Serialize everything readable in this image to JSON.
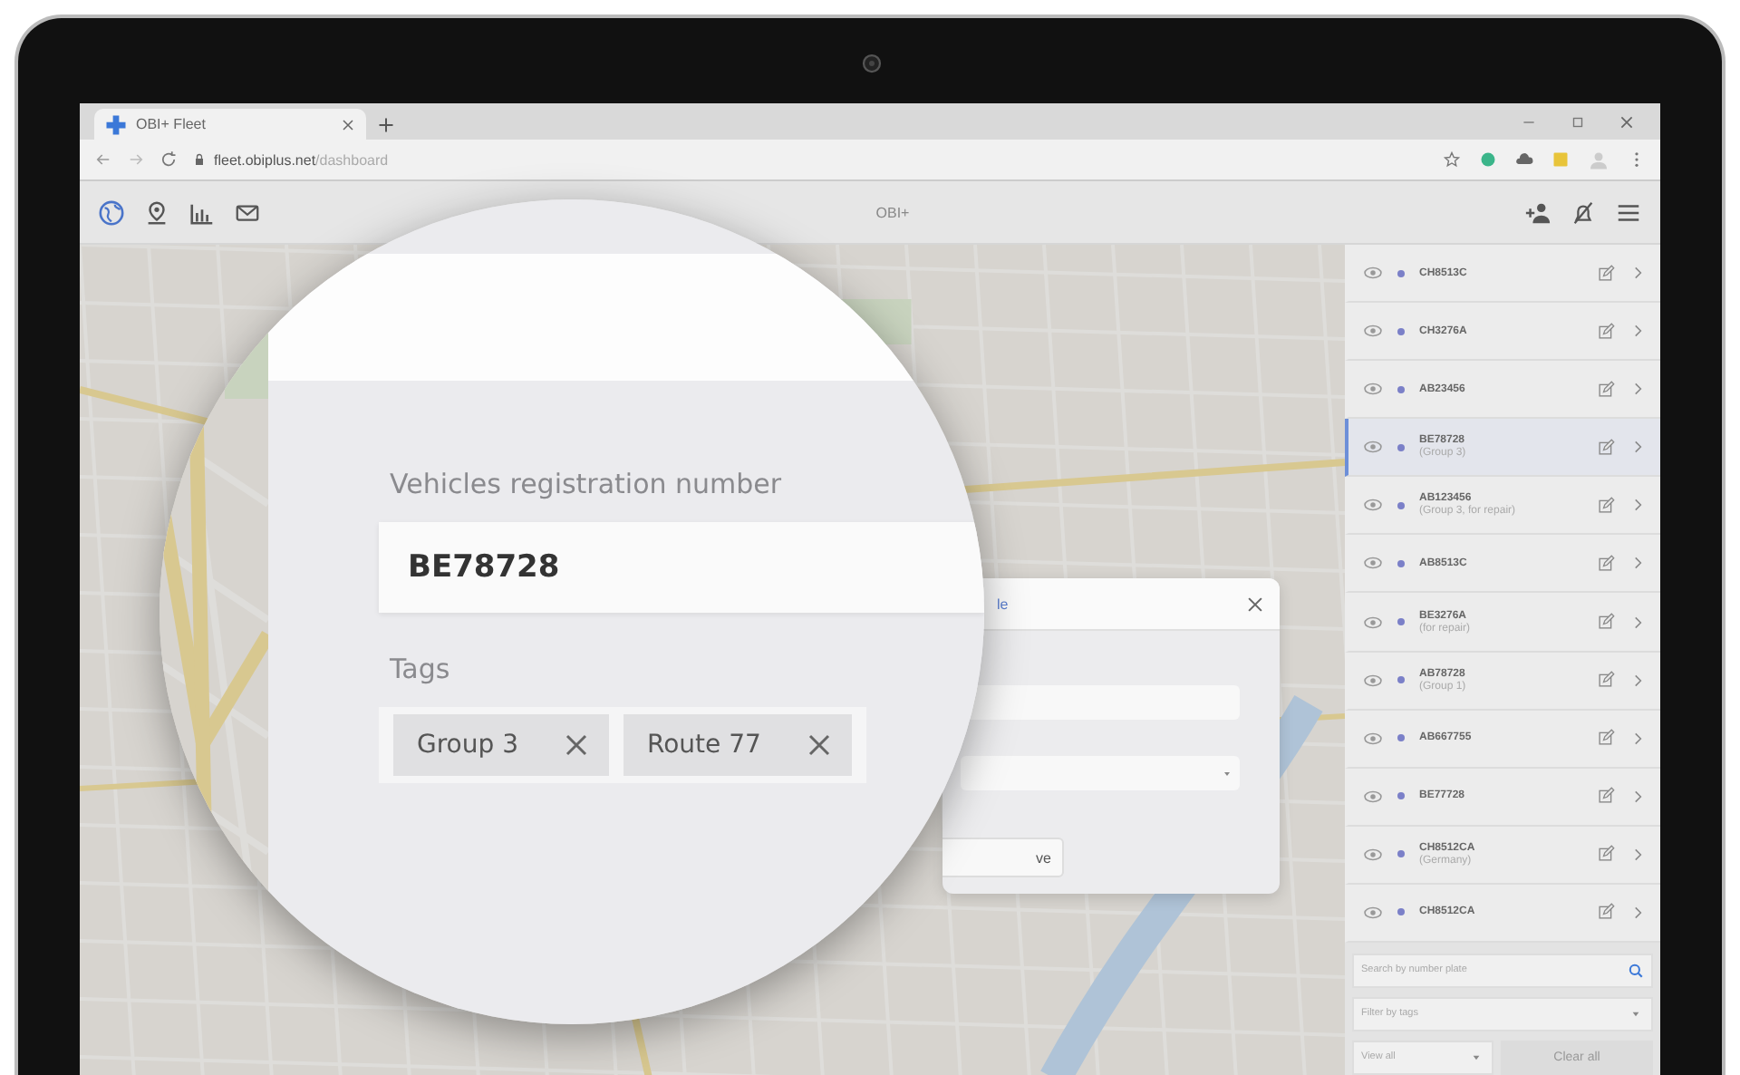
{
  "browser": {
    "tab_title": "OBI+ Fleet",
    "url_host": "fleet.obiplus.net",
    "url_path": "/dashboard"
  },
  "app": {
    "title": "OBI+"
  },
  "vehicles": [
    {
      "plate": "CH8513C",
      "selected": false
    },
    {
      "plate": "CH3276A",
      "selected": false
    },
    {
      "plate": "AB23456",
      "selected": false
    },
    {
      "plate": "BE78728",
      "note": "(Group 3)",
      "selected": true
    },
    {
      "plate": "AB123456",
      "note": "(Group 3, for repair)",
      "selected": false
    },
    {
      "plate": "AB8513C",
      "selected": false
    },
    {
      "plate": "BE3276A",
      "note": "(for repair)",
      "selected": false
    },
    {
      "plate": "AB78728",
      "note": "(Group 1)",
      "selected": false
    },
    {
      "plate": "AB667755",
      "selected": false
    },
    {
      "plate": "BE77728",
      "selected": false
    },
    {
      "plate": "CH8512CA",
      "note": "(Germany)",
      "selected": false
    },
    {
      "plate": "CH8512CA",
      "selected": false
    }
  ],
  "search": {
    "placeholder": "Search by number plate"
  },
  "tag_filter": {
    "placeholder": "Filter by tags"
  },
  "view_select": {
    "value": "View all"
  },
  "clear_button": {
    "label": "Clear all"
  },
  "dialog": {
    "title": "le",
    "save_button": "ve"
  },
  "magnifier": {
    "field_label": "Vehicles registration number",
    "value": "BE78728",
    "tags_label": "Tags",
    "tags": [
      "Group 3",
      "Route 77"
    ]
  }
}
